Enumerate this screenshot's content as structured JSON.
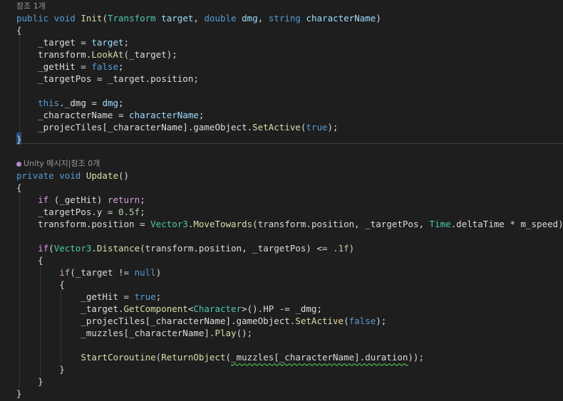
{
  "colors": {
    "keyword": "#569cd6",
    "control": "#d8a0df",
    "type": "#4ec9b0",
    "method": "#dcdcaa",
    "param": "#9cdcfe",
    "number": "#b5cea8",
    "plain": "#dcdcdc",
    "lens": "#999999"
  },
  "lines": [
    {
      "kind": "lens",
      "tokens": [
        {
          "t": "참조 1개",
          "c": "lens"
        }
      ]
    },
    {
      "tokens": [
        {
          "t": "public",
          "c": "keyword"
        },
        {
          "t": " "
        },
        {
          "t": "void",
          "c": "keyword"
        },
        {
          "t": " "
        },
        {
          "t": "Init",
          "c": "method"
        },
        {
          "t": "("
        },
        {
          "t": "Transform",
          "c": "type"
        },
        {
          "t": " "
        },
        {
          "t": "target",
          "c": "param"
        },
        {
          "t": ", "
        },
        {
          "t": "double",
          "c": "keyword"
        },
        {
          "t": " "
        },
        {
          "t": "dmg",
          "c": "param"
        },
        {
          "t": ", "
        },
        {
          "t": "string",
          "c": "keyword"
        },
        {
          "t": " "
        },
        {
          "t": "characterName",
          "c": "param"
        },
        {
          "t": ")"
        }
      ]
    },
    {
      "tokens": [
        {
          "t": "{"
        }
      ]
    },
    {
      "tokens": [
        {
          "t": "    _target = "
        },
        {
          "t": "target",
          "c": "param"
        },
        {
          "t": ";"
        }
      ]
    },
    {
      "tokens": [
        {
          "t": "    transform."
        },
        {
          "t": "LookAt",
          "c": "method"
        },
        {
          "t": "(_target);"
        }
      ]
    },
    {
      "tokens": [
        {
          "t": "    _getHit = "
        },
        {
          "t": "false",
          "c": "keyword"
        },
        {
          "t": ";"
        }
      ]
    },
    {
      "tokens": [
        {
          "t": "    _targetPos = _target.position;"
        }
      ]
    },
    {
      "tokens": []
    },
    {
      "tokens": [
        {
          "t": "    "
        },
        {
          "t": "this",
          "c": "keyword"
        },
        {
          "t": "._dmg = "
        },
        {
          "t": "dmg",
          "c": "param"
        },
        {
          "t": ";"
        }
      ]
    },
    {
      "tokens": [
        {
          "t": "    _characterName = "
        },
        {
          "t": "characterName",
          "c": "param"
        },
        {
          "t": ";"
        }
      ]
    },
    {
      "tokens": [
        {
          "t": "    _projecTiles[_characterName].gameObject."
        },
        {
          "t": "SetActive",
          "c": "method"
        },
        {
          "t": "("
        },
        {
          "t": "true",
          "c": "keyword"
        },
        {
          "t": ");"
        }
      ]
    },
    {
      "tokens": [
        {
          "t": "}"
        }
      ]
    },
    {
      "tokens": []
    },
    {
      "kind": "lens",
      "unity": true,
      "tokens": [
        {
          "t": "Unity 메시지|참조 0개",
          "c": "lens"
        }
      ]
    },
    {
      "tokens": [
        {
          "t": "private",
          "c": "keyword"
        },
        {
          "t": " "
        },
        {
          "t": "void",
          "c": "keyword"
        },
        {
          "t": " "
        },
        {
          "t": "Update",
          "c": "method"
        },
        {
          "t": "()"
        }
      ]
    },
    {
      "tokens": [
        {
          "t": "{"
        }
      ]
    },
    {
      "tokens": [
        {
          "t": "    "
        },
        {
          "t": "if",
          "c": "control"
        },
        {
          "t": " (_getHit) "
        },
        {
          "t": "return",
          "c": "control"
        },
        {
          "t": ";"
        }
      ]
    },
    {
      "tokens": [
        {
          "t": "    _targetPos.y = "
        },
        {
          "t": "0.5f",
          "c": "number"
        },
        {
          "t": ";"
        }
      ]
    },
    {
      "tokens": [
        {
          "t": "    transform.position = "
        },
        {
          "t": "Vector3",
          "c": "type"
        },
        {
          "t": "."
        },
        {
          "t": "MoveTowards",
          "c": "method"
        },
        {
          "t": "(transform.position, _targetPos, "
        },
        {
          "t": "Time",
          "c": "type"
        },
        {
          "t": ".deltaTime * m_speed);"
        }
      ]
    },
    {
      "tokens": []
    },
    {
      "tokens": [
        {
          "t": "    "
        },
        {
          "t": "if",
          "c": "control"
        },
        {
          "t": "("
        },
        {
          "t": "Vector3",
          "c": "type"
        },
        {
          "t": "."
        },
        {
          "t": "Distance",
          "c": "method"
        },
        {
          "t": "(transform.position, _targetPos) <= "
        },
        {
          "t": ".1f",
          "c": "number"
        },
        {
          "t": ")"
        }
      ]
    },
    {
      "tokens": [
        {
          "t": "    {"
        }
      ]
    },
    {
      "tokens": [
        {
          "t": "        "
        },
        {
          "t": "if",
          "c": "control"
        },
        {
          "t": "(_target != "
        },
        {
          "t": "null",
          "c": "keyword"
        },
        {
          "t": ")"
        }
      ]
    },
    {
      "tokens": [
        {
          "t": "        {"
        }
      ]
    },
    {
      "tokens": [
        {
          "t": "            _getHit = "
        },
        {
          "t": "true",
          "c": "keyword"
        },
        {
          "t": ";"
        }
      ]
    },
    {
      "tokens": [
        {
          "t": "            _target."
        },
        {
          "t": "GetComponent",
          "c": "method"
        },
        {
          "t": "<"
        },
        {
          "t": "Character",
          "c": "type"
        },
        {
          "t": ">().HP -= _dmg;"
        }
      ]
    },
    {
      "tokens": [
        {
          "t": "            _projecTiles[_characterName].gameObject."
        },
        {
          "t": "SetActive",
          "c": "method"
        },
        {
          "t": "("
        },
        {
          "t": "false",
          "c": "keyword"
        },
        {
          "t": ");"
        }
      ]
    },
    {
      "tokens": [
        {
          "t": "            _muzzles[_characterName]."
        },
        {
          "t": "Play",
          "c": "method"
        },
        {
          "t": "();"
        }
      ]
    },
    {
      "tokens": []
    },
    {
      "tokens": [
        {
          "t": "            "
        },
        {
          "t": "StartCoroutine",
          "c": "method"
        },
        {
          "t": "("
        },
        {
          "t": "ReturnObject",
          "c": "method"
        },
        {
          "t": "("
        },
        {
          "t": "_muzzles[_characterName].duration",
          "w": true
        },
        {
          "t": "));"
        }
      ]
    },
    {
      "tokens": [
        {
          "t": "        }"
        }
      ]
    },
    {
      "tokens": [
        {
          "t": "    }"
        }
      ]
    },
    {
      "tokens": [
        {
          "t": "}"
        }
      ]
    }
  ]
}
